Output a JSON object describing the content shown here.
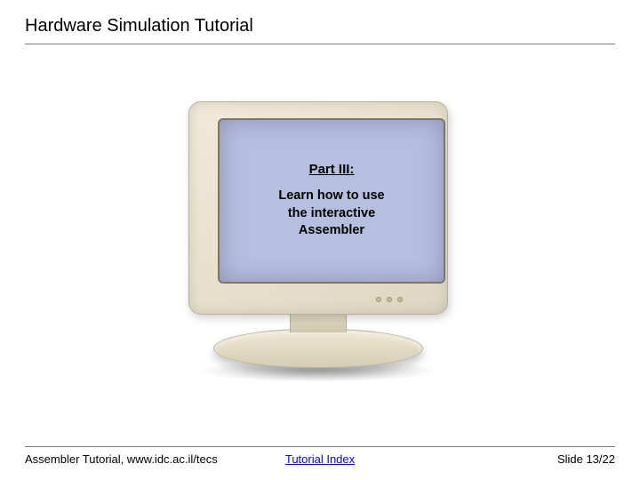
{
  "header": {
    "title": "Hardware Simulation Tutorial"
  },
  "screen": {
    "part_label": "Part III:",
    "body_line1": "Learn how to use",
    "body_line2": "the interactive",
    "body_line3": "Assembler"
  },
  "footer": {
    "left": "Assembler Tutorial, www.idc.ac.il/tecs",
    "link": "Tutorial Index",
    "right": "Slide 13/22"
  }
}
